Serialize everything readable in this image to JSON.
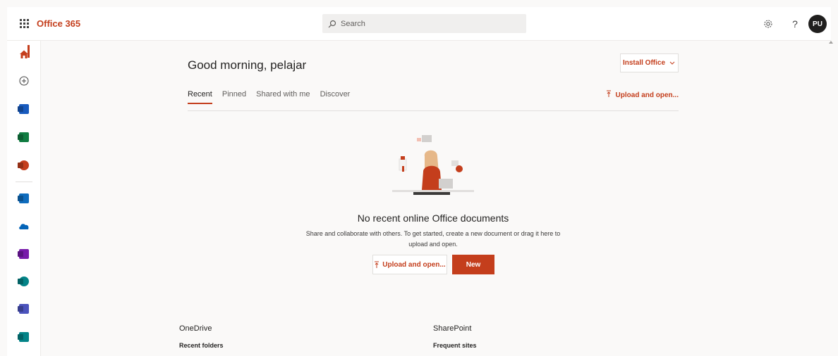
{
  "app": {
    "brand": "Office 365",
    "user_initials": "PU"
  },
  "search": {
    "label": "Search"
  },
  "header": {
    "settings_icon": "gear-icon",
    "help_label": "?"
  },
  "rail": {
    "items": [
      {
        "name": "home",
        "icon": "home-icon",
        "color": "#c43e1c",
        "active": true
      },
      {
        "name": "create",
        "icon": "plus-circle-icon"
      },
      {
        "name": "word",
        "icon": "word-icon",
        "color": "#185abd"
      },
      {
        "name": "excel",
        "icon": "excel-icon",
        "color": "#107c41"
      },
      {
        "name": "powerpoint",
        "icon": "powerpoint-icon",
        "color": "#c43e1c"
      },
      {
        "name": "outlook",
        "icon": "outlook-icon",
        "color": "#0f6cbd"
      },
      {
        "name": "onedrive",
        "icon": "onedrive-icon",
        "color": "#0364b8"
      },
      {
        "name": "onenote",
        "icon": "onenote-icon",
        "color": "#7719aa"
      },
      {
        "name": "sharepoint",
        "icon": "sharepoint-icon",
        "color": "#038387"
      },
      {
        "name": "teams",
        "icon": "teams-icon",
        "color": "#4b53bc"
      },
      {
        "name": "sway",
        "icon": "sway-icon",
        "color": "#038387"
      }
    ]
  },
  "main": {
    "greeting": "Good morning, pelajar",
    "install_label": "Install Office",
    "upload_top_label": "Upload and open...",
    "tabs": [
      {
        "label": "Recent",
        "active": true
      },
      {
        "label": "Pinned"
      },
      {
        "label": "Shared with me"
      },
      {
        "label": "Discover"
      }
    ],
    "empty": {
      "title": "No recent online Office documents",
      "description": "Share and collaborate with others. To get started, create a new document or drag it here to upload and open."
    },
    "upload_button_label": "Upload and open...",
    "new_button_label": "New"
  },
  "sections": {
    "onedrive": {
      "title": "OneDrive",
      "subtitle": "Recent folders"
    },
    "sharepoint": {
      "title": "SharePoint",
      "subtitle": "Frequent sites"
    }
  },
  "colors": {
    "accent": "#c43e1c",
    "background": "#faf9f8"
  }
}
